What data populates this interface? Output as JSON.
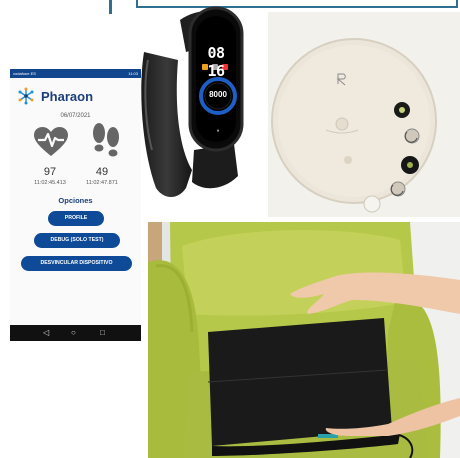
{
  "phone": {
    "status_left": "vodafone ES",
    "status_right": "11:03",
    "app_title": "Pharaon",
    "date": "06/07/2021",
    "heart_rate": "97",
    "heart_time": "11:02:45.413",
    "steps": "49",
    "steps_time": "11:02:47.871",
    "options_title": "Opciones",
    "buttons": [
      "PROFILE",
      "DEBUG (SOLO TEST)",
      "DESVINCULAR DISPOSITIVO"
    ],
    "nav": {
      "back": "◁",
      "home": "○",
      "recents": "□"
    }
  },
  "band": {
    "time_hours": "08",
    "time_minutes": "16",
    "steps": "8000"
  },
  "colors": {
    "brand_blue": "#0e4a98",
    "chair_green": "#b9c94a",
    "border_teal": "#2f6f8f"
  }
}
